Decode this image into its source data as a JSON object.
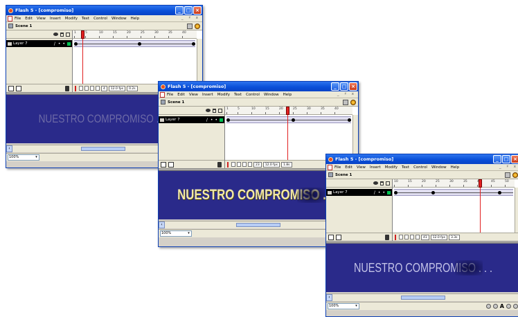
{
  "windows": [
    {
      "title": "Flash 5 - [compromiso]",
      "menus": [
        "File",
        "Edit",
        "View",
        "Insert",
        "Modify",
        "Text",
        "Control",
        "Window",
        "Help"
      ],
      "window_controls": "_ ♯ x",
      "scene": "Scene 1",
      "timeline_ticks": [
        "1",
        "5",
        "10",
        "15",
        "20",
        "25",
        "30",
        "35",
        "40"
      ],
      "playhead_frame": 4,
      "layer_name": "Layer 7",
      "footer_frame": "4",
      "footer_fps": "12.0 fps",
      "footer_time": "0.2s",
      "stage_text": "NUESTRO COMPROMISO . . .",
      "zoom": "100%"
    },
    {
      "title": "Flash 5 - [compromiso]",
      "menus": [
        "File",
        "Edit",
        "View",
        "Insert",
        "Modify",
        "Text",
        "Control",
        "Window",
        "Help"
      ],
      "window_controls": "_ ♯ x",
      "scene": "Scene 1",
      "timeline_ticks": [
        "1",
        "5",
        "10",
        "15",
        "20",
        "25",
        "30",
        "35",
        "40"
      ],
      "playhead_frame": 23,
      "layer_name": "Layer 7",
      "footer_frame": "23",
      "footer_fps": "12.0 fps",
      "footer_time": "1.8s",
      "stage_text": "NUESTRO COMPROMISO . . .",
      "zoom": "100%"
    },
    {
      "title": "Flash 5 - [compromiso]",
      "menus": [
        "File",
        "Edit",
        "View",
        "Insert",
        "Modify",
        "Text",
        "Control",
        "Window",
        "Help"
      ],
      "window_controls": "_ ♯ x",
      "scene": "Scene 1",
      "timeline_ticks": [
        "10",
        "15",
        "20",
        "25",
        "30",
        "35",
        "40",
        "45",
        "50"
      ],
      "playhead_frame": 41,
      "layer_name": "Layer 7",
      "footer_frame": "41",
      "footer_fps": "12.0 fps",
      "footer_time": "3.3s",
      "stage_text": "NUESTRO COMPROMISO . . .",
      "zoom": "100%"
    }
  ],
  "colors": {
    "titlebar": "#0a50d8",
    "stage_background": "#2a2a8a",
    "playhead": "#e12020",
    "frame_span": "#e0def0"
  },
  "icons": [
    "app-flash-icon",
    "minimize-icon",
    "maximize-icon",
    "close-icon",
    "scene-icon",
    "edit-scene-icon",
    "edit-symbol-icon",
    "eye-icon",
    "lock-icon",
    "outline-icon",
    "pencil-icon",
    "add-layer-icon",
    "add-guide-layer-icon",
    "trash-icon",
    "onion-skin-icon",
    "text-tool-icon"
  ]
}
